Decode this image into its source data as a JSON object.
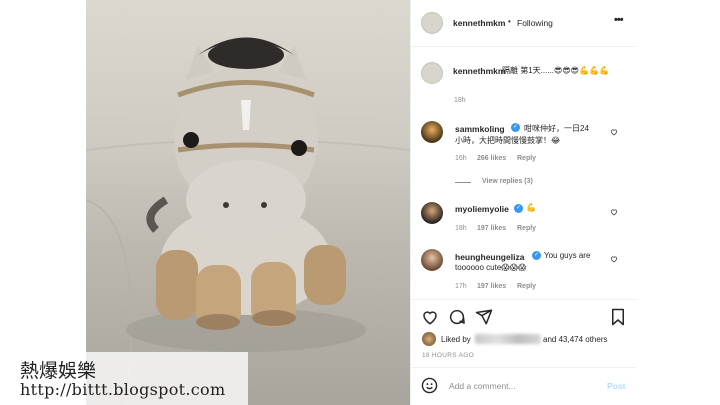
{
  "header": {
    "username": "kennethmkm",
    "separator": "•",
    "follow_status": "Following",
    "more_icon": "more-horizontal-icon"
  },
  "caption": {
    "username": "kennethmkm",
    "text": "隔離 第1天......😎😎😎💪💪💪",
    "time": "18h"
  },
  "comments": [
    {
      "username": "sammkoling",
      "verified": true,
      "text_line1": "咁咪仲好，一日24",
      "text_line2": "小時，大把時間慢慢鼓掌！😂",
      "time": "16h",
      "likes": "266 likes",
      "reply": "Reply"
    },
    {
      "username": "myoliemyolie",
      "verified": true,
      "text_line1": "💪",
      "time": "18h",
      "likes": "197 likes",
      "reply": "Reply"
    },
    {
      "username": "heungheungeliza",
      "verified": true,
      "text_line1": "You guys are",
      "text_line2": "toooooo cute😱😱😱",
      "time": "17h",
      "likes": "197 likes",
      "reply": "Reply"
    }
  ],
  "view_replies": "View replies (3)",
  "actions": {
    "like_icon": "heart-icon",
    "comment_icon": "comment-icon",
    "share_icon": "share-icon",
    "save_icon": "bookmark-icon"
  },
  "likes": {
    "prefix": "Liked by",
    "suffix": "and 43,474 others"
  },
  "post_time": "18 HOURS AGO",
  "add_comment": {
    "placeholder": "Add a comment...",
    "post_label": "Post",
    "emoji_icon": "smile-icon"
  },
  "watermark": {
    "line1": "熱爆娛樂",
    "line2": "http://bittt.blogspot.com"
  },
  "colors": {
    "accent_blue": "#0095f6",
    "post_disabled": "#b2dffc",
    "muted": "#8e8e8e",
    "verified": "#3897f0"
  }
}
